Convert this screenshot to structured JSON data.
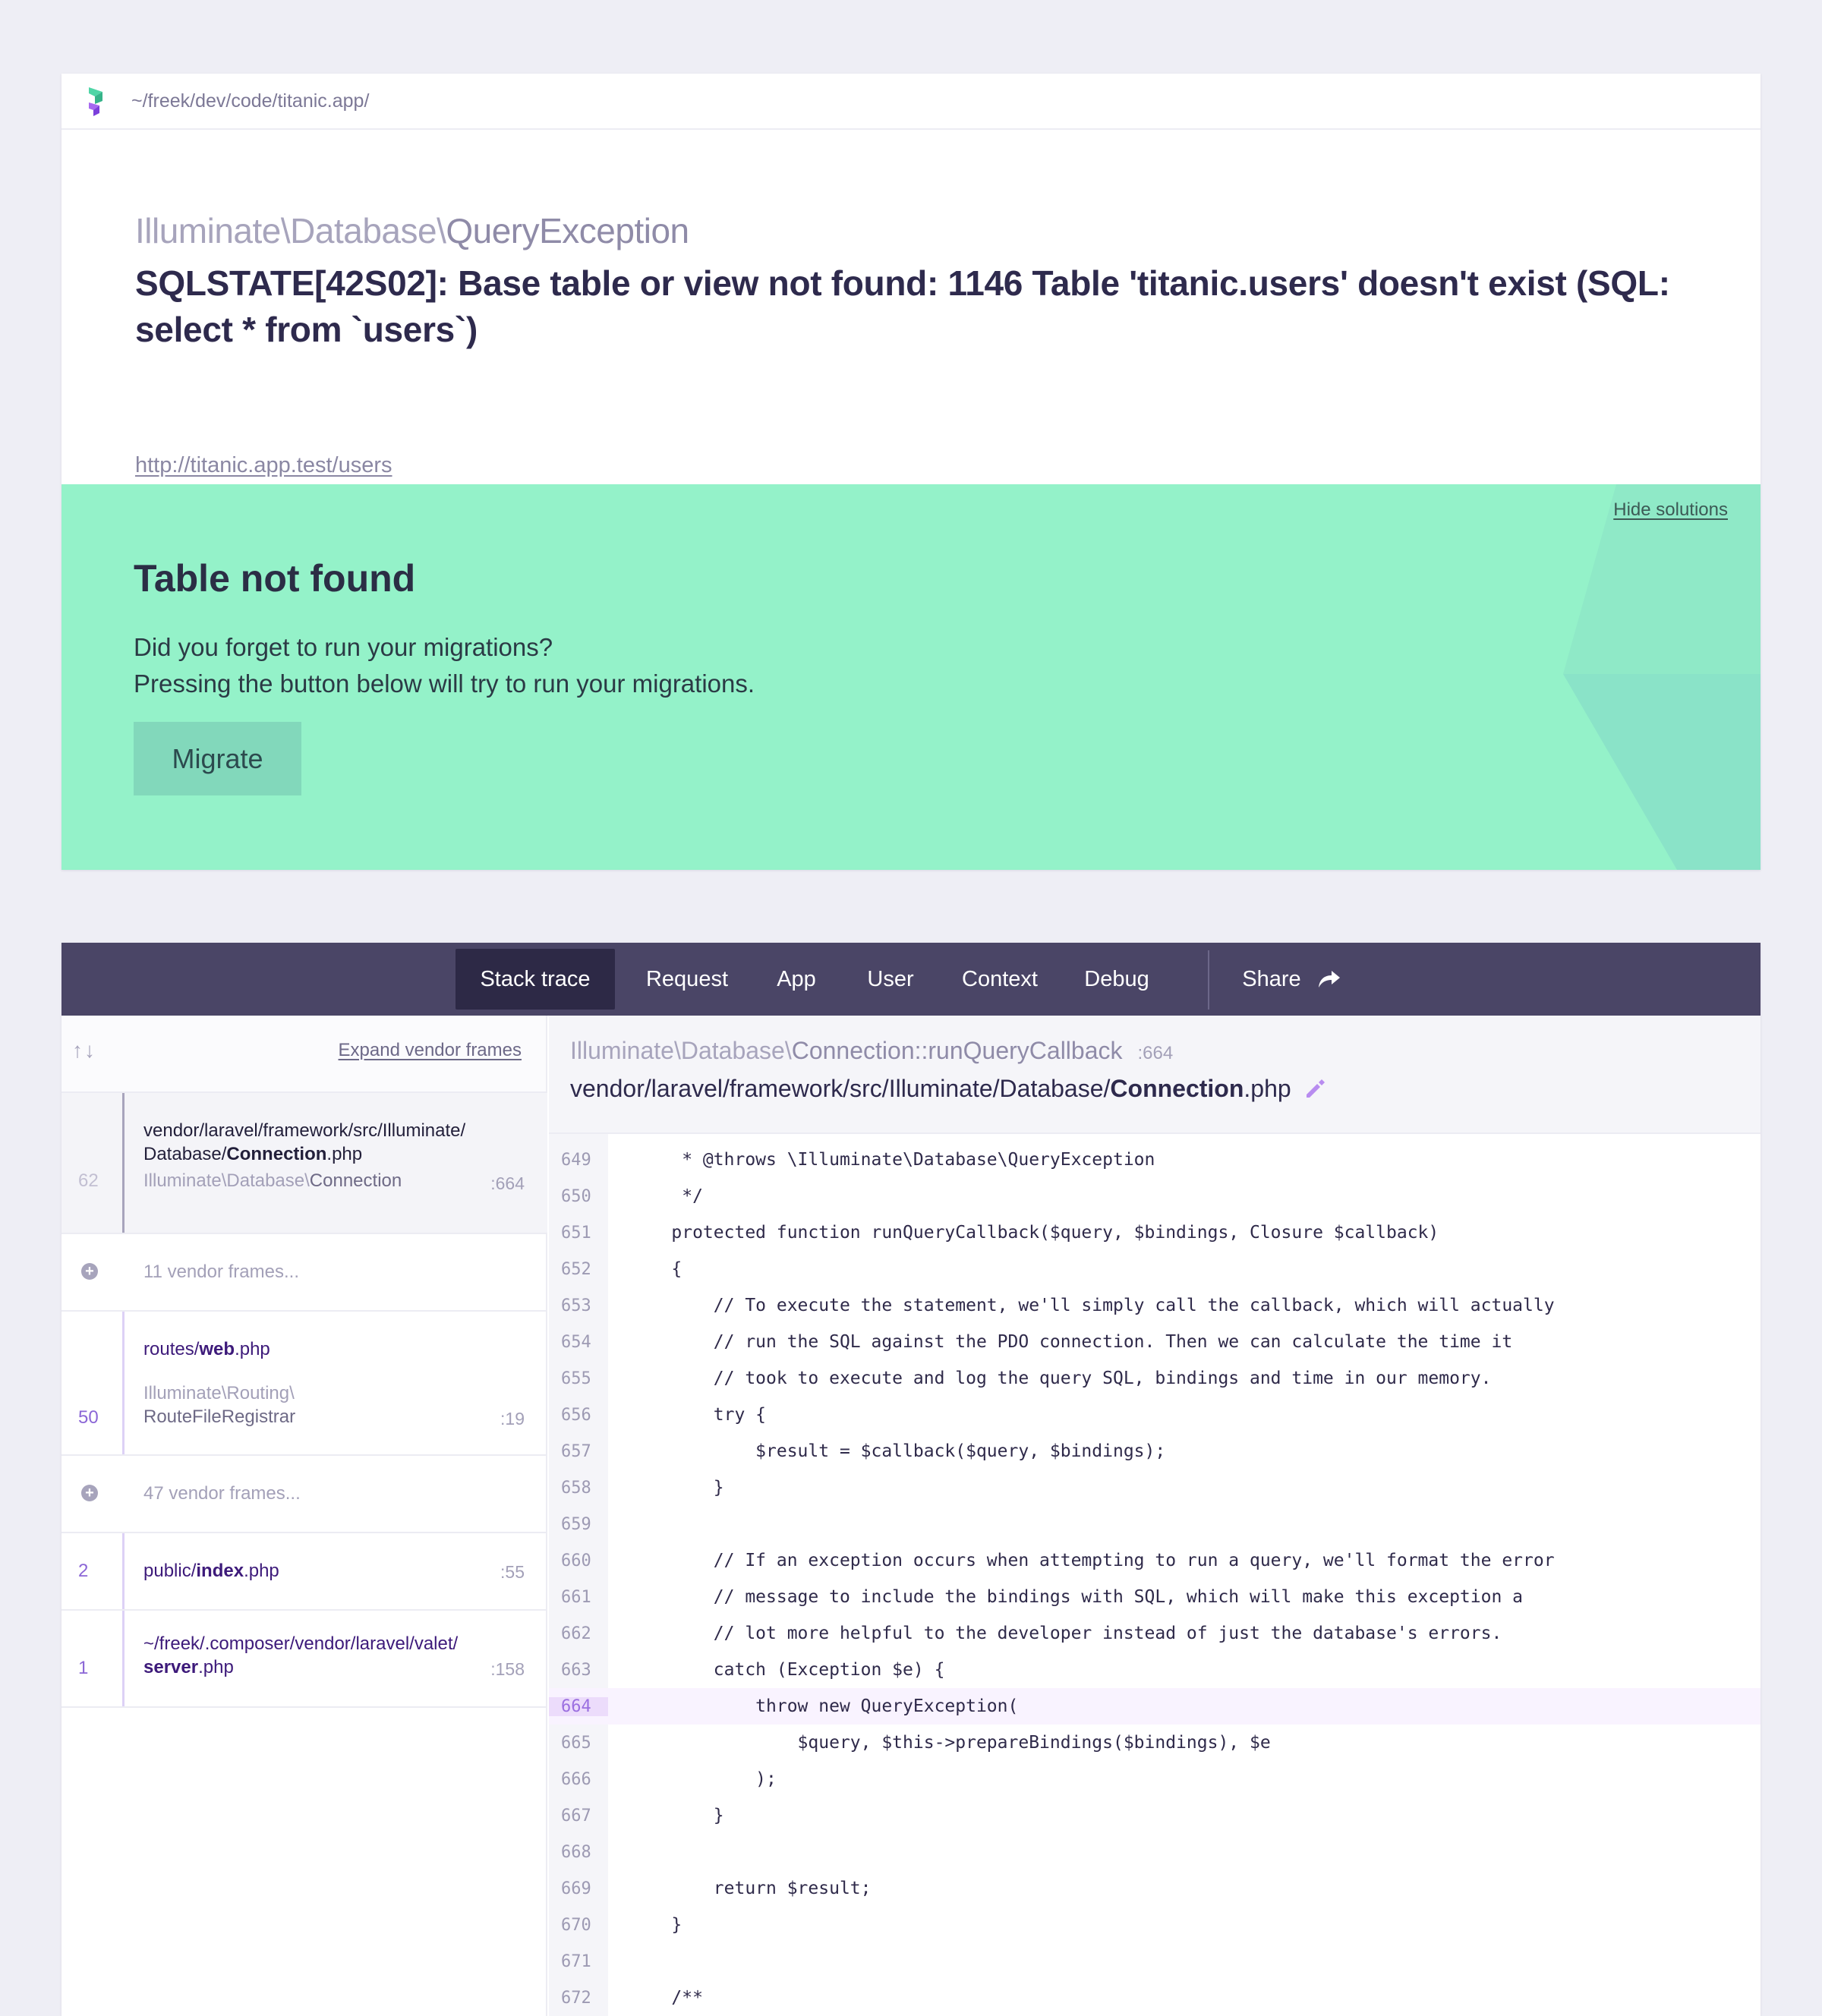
{
  "header": {
    "path": "~/freek/dev/code/titanic.app/"
  },
  "exception": {
    "class_prefix": "Illuminate\\Database\\",
    "class_name": "QueryException",
    "message": "SQLSTATE[42S02]: Base table or view not found: 1146 Table 'titanic.users' doesn't exist (SQL: select * from `users`)",
    "url": "http://titanic.app.test/users"
  },
  "solution": {
    "hide_label": "Hide solutions",
    "title": "Table not found",
    "line1": "Did you forget to run your migrations?",
    "line2": "Pressing the button below will try to run your migrations.",
    "button": "Migrate",
    "colors": {
      "background": "#94f2c9",
      "button": "#82d8bb"
    }
  },
  "tabs": {
    "stack_trace": "Stack trace",
    "request": "Request",
    "app": "App",
    "user": "User",
    "context": "Context",
    "debug": "Debug",
    "share": "Share"
  },
  "frames_panel": {
    "arrows": "↑↓",
    "expand_label": "Expand vendor frames",
    "frames": [
      {
        "num": "62",
        "path": "vendor/laravel/framework/src/Illuminate/",
        "file_dir": "Database/",
        "file_name": "Connection",
        "file_ext": ".php",
        "class_prefix": "Illuminate\\Database\\",
        "class_name": "Connection",
        "line": ":664"
      },
      {
        "vendor_text": "11 vendor frames..."
      },
      {
        "num": "50",
        "path_prefix": "routes/",
        "file_name": "web",
        "file_ext": ".php",
        "class_prefix": "Illuminate\\Routing\\",
        "class_name": "RouteFileRegistrar",
        "line": ":19"
      },
      {
        "vendor_text": "47 vendor frames..."
      },
      {
        "num": "2",
        "path_prefix": "public/",
        "file_name": "index",
        "file_ext": ".php",
        "line": ":55"
      },
      {
        "num": "1",
        "path": "~/freek/.composer/vendor/laravel/valet/",
        "file_name": "server",
        "file_ext": ".php",
        "line": ":158"
      }
    ]
  },
  "code_header": {
    "class_prefix": "Illuminate\\Database\\",
    "class_method": "Connection::runQueryCallback",
    "line": ":664",
    "file_path": "vendor/laravel/framework/src/Illuminate/Database/",
    "file_name": "Connection",
    "file_ext": ".php"
  },
  "code": {
    "highlight_line": "664",
    "lines": [
      {
        "n": "649",
        "t": "     * @throws \\Illuminate\\Database\\QueryException"
      },
      {
        "n": "650",
        "t": "     */"
      },
      {
        "n": "651",
        "t": "    protected function runQueryCallback($query, $bindings, Closure $callback)"
      },
      {
        "n": "652",
        "t": "    {"
      },
      {
        "n": "653",
        "t": "        // To execute the statement, we'll simply call the callback, which will actually"
      },
      {
        "n": "654",
        "t": "        // run the SQL against the PDO connection. Then we can calculate the time it"
      },
      {
        "n": "655",
        "t": "        // took to execute and log the query SQL, bindings and time in our memory."
      },
      {
        "n": "656",
        "t": "        try {"
      },
      {
        "n": "657",
        "t": "            $result = $callback($query, $bindings);"
      },
      {
        "n": "658",
        "t": "        }"
      },
      {
        "n": "659",
        "t": ""
      },
      {
        "n": "660",
        "t": "        // If an exception occurs when attempting to run a query, we'll format the error"
      },
      {
        "n": "661",
        "t": "        // message to include the bindings with SQL, which will make this exception a"
      },
      {
        "n": "662",
        "t": "        // lot more helpful to the developer instead of just the database's errors."
      },
      {
        "n": "663",
        "t": "        catch (Exception $e) {"
      },
      {
        "n": "664",
        "t": "            throw new QueryException("
      },
      {
        "n": "665",
        "t": "                $query, $this->prepareBindings($bindings), $e"
      },
      {
        "n": "666",
        "t": "            );"
      },
      {
        "n": "667",
        "t": "        }"
      },
      {
        "n": "668",
        "t": ""
      },
      {
        "n": "669",
        "t": "        return $result;"
      },
      {
        "n": "670",
        "t": "    }"
      },
      {
        "n": "671",
        "t": ""
      },
      {
        "n": "672",
        "t": "    /**"
      }
    ]
  },
  "colors": {
    "page_background": "#eeeef5",
    "tabbar": "#4a4566",
    "tab_active": "#2d2946",
    "frame_accent": "#8b66d6",
    "highlight_line": "#ecdcfb"
  },
  "icons": {
    "logo": "ignition-logo-icon",
    "share": "share-arrow-icon",
    "edit": "pencil-icon",
    "expand_vendor": "plus-circle-icon"
  }
}
